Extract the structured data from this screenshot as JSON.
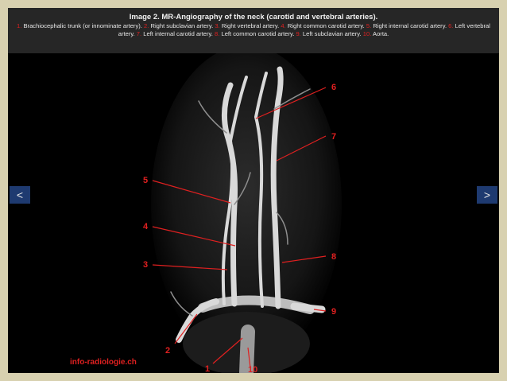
{
  "caption": {
    "title": "Image 2. MR-Angiography of the neck (carotid and vertebral arteries).",
    "items": [
      {
        "num": "1.",
        "text": " Brachiocephalic trunk (or innominate artery). "
      },
      {
        "num": "2.",
        "text": " Right subclavian artery. "
      },
      {
        "num": "3.",
        "text": " Right vertebral artery. "
      },
      {
        "num": "4.",
        "text": " Right common carotid artery. "
      },
      {
        "num": "5.",
        "text": " Right internal carotid artery. "
      },
      {
        "num": "6.",
        "text": " Left vertebral artery. "
      },
      {
        "num": "7.",
        "text": " Left internal carotid artery. "
      },
      {
        "num": "8.",
        "text": " Left common carotid artery. "
      },
      {
        "num": "9.",
        "text": " Left subclavian artery. "
      },
      {
        "num": "10.",
        "text": " Aorta."
      }
    ]
  },
  "navigation": {
    "prev_label": "<",
    "next_label": ">"
  },
  "image": {
    "watermark": "info-radiologie.ch",
    "labels": [
      "1",
      "2",
      "3",
      "4",
      "5",
      "6",
      "7",
      "8",
      "9",
      "10"
    ],
    "label_color": "#e02020",
    "vessel_color": "#d9d9d9"
  }
}
